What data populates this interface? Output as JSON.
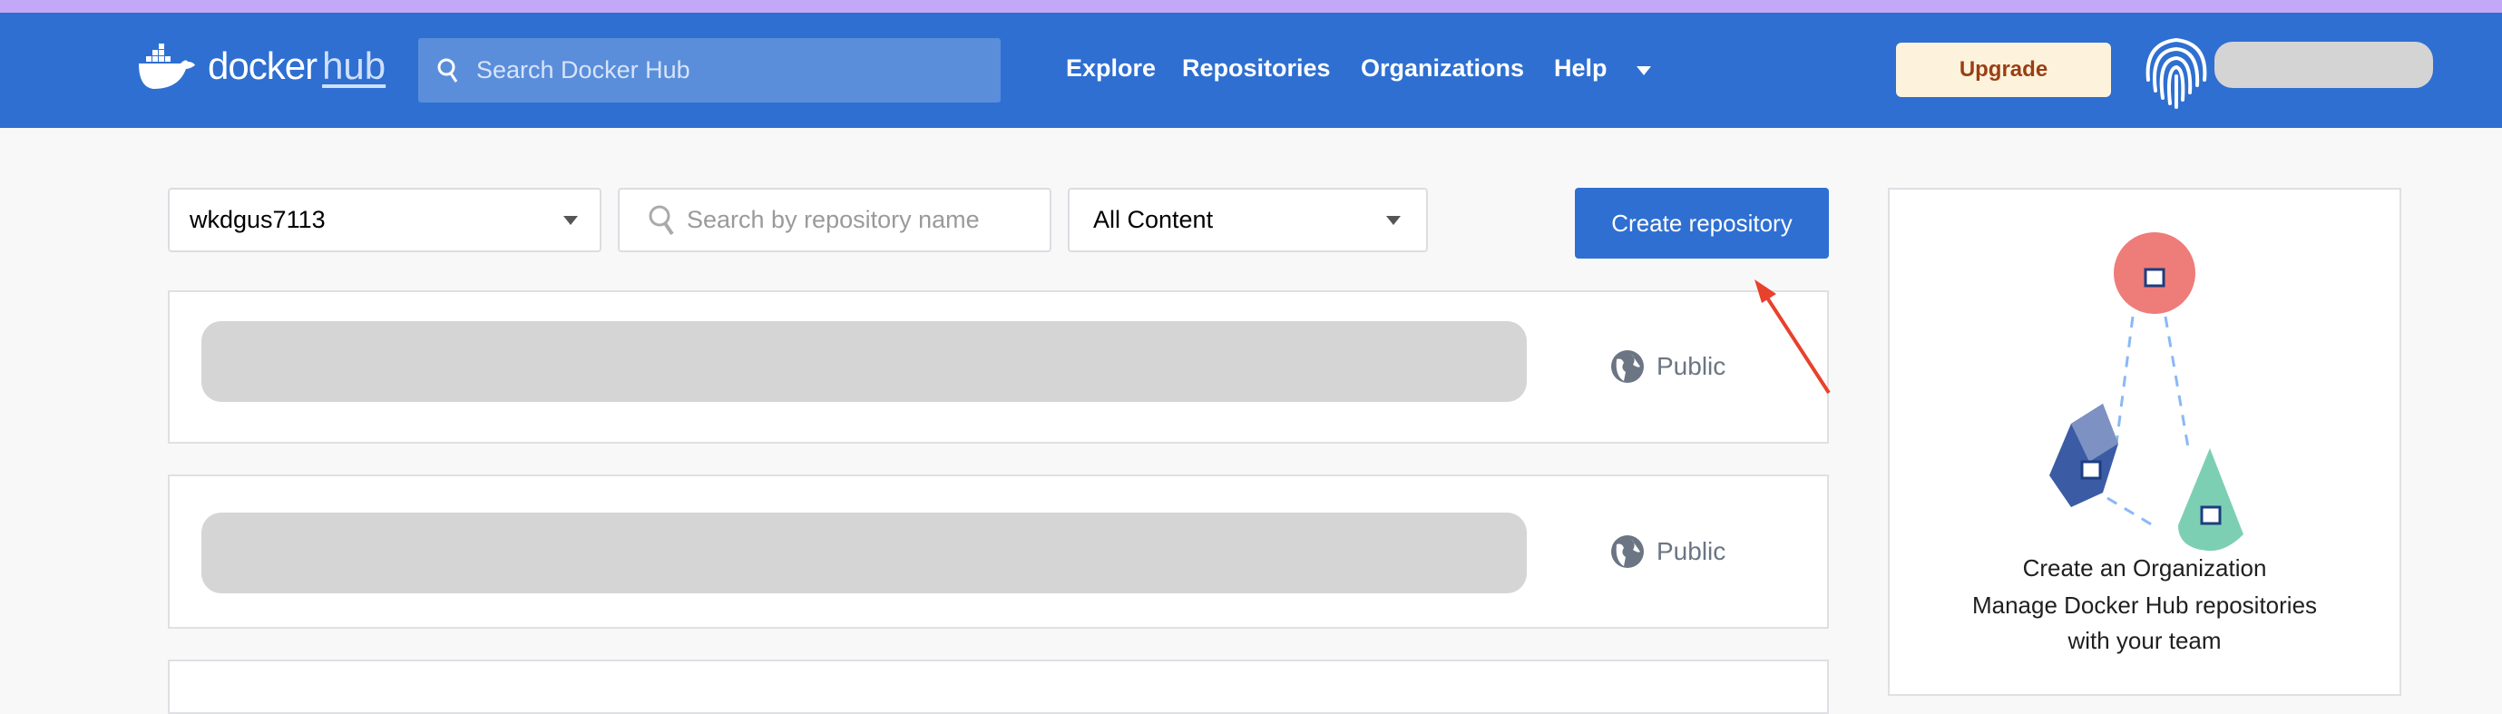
{
  "header": {
    "logo": {
      "word1": "docker",
      "word2": "hub"
    },
    "search_placeholder": "Search Docker Hub",
    "nav": [
      "Explore",
      "Repositories",
      "Organizations",
      "Help"
    ],
    "upgrade_label": "Upgrade"
  },
  "toolbar": {
    "namespace_value": "wkdgus7113",
    "search_placeholder": "Search by repository name",
    "content_filter_value": "All Content",
    "create_label": "Create repository"
  },
  "repositories": [
    {
      "visibility": "Public"
    },
    {
      "visibility": "Public"
    }
  ],
  "org_card": {
    "title": "Create an Organization",
    "line1": "Manage Docker Hub repositories",
    "line2": "with your team"
  },
  "colors": {
    "header": "#2e6fd1",
    "accent_bar": "#c3a8f7",
    "annotation_arrow": "#e8412c"
  }
}
